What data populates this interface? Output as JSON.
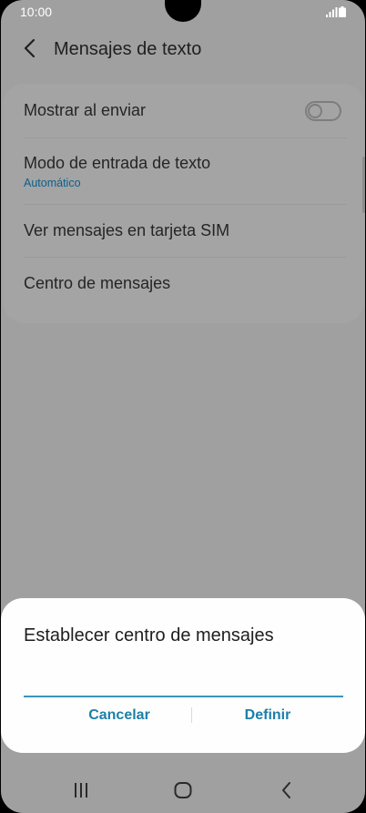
{
  "status_bar": {
    "time": "10:00",
    "icons": [
      "signal-icon",
      "battery-icon"
    ]
  },
  "header": {
    "back_icon": "chevron-left-icon",
    "title": "Mensajes de texto"
  },
  "settings": {
    "items": [
      {
        "label": "Mostrar al enviar",
        "control": "toggle",
        "toggle_on": false
      },
      {
        "label": "Modo de entrada de texto",
        "sub": "Automático"
      },
      {
        "label": "Ver mensajes en tarjeta SIM"
      },
      {
        "label": "Centro de mensajes"
      }
    ]
  },
  "dialog": {
    "title": "Establecer centro de mensajes",
    "input_value": "",
    "cancel_label": "Cancelar",
    "confirm_label": "Definir"
  },
  "nav_bar": {
    "icons": [
      "recent-apps-icon",
      "home-icon",
      "back-icon"
    ]
  },
  "colors": {
    "scrim": "#a0a0a0",
    "accent": "#1b7fa8",
    "input_underline": "#3a95b7",
    "dialog_bg": "#fefefe"
  }
}
